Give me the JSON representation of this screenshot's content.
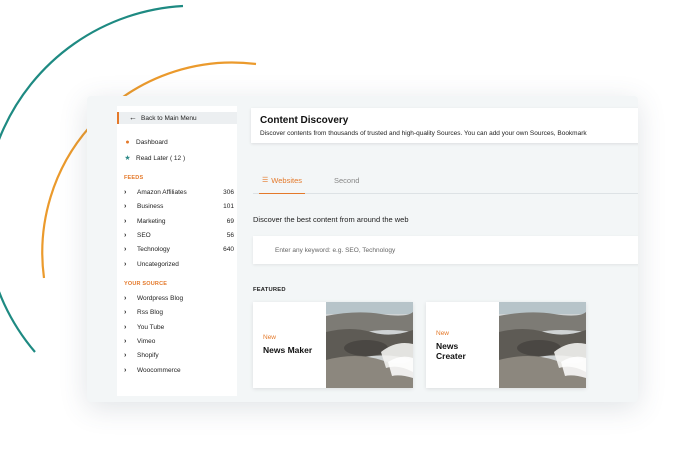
{
  "sidebar": {
    "back_label": "Back to Main Menu",
    "top_items": [
      {
        "label": "Dashboard",
        "icon": "dashboard-icon"
      },
      {
        "label": "Read Later ( 12 )",
        "icon": "star-icon"
      }
    ],
    "feeds_title": "FEEDS",
    "feeds": [
      {
        "label": "Amazon Affiliates",
        "count": "306"
      },
      {
        "label": "Business",
        "count": "101"
      },
      {
        "label": "Marketing",
        "count": "69"
      },
      {
        "label": "SEO",
        "count": "56"
      },
      {
        "label": "Technology",
        "count": "640"
      },
      {
        "label": "Uncategorized",
        "count": ""
      }
    ],
    "source_title": "YOUR SOURCE",
    "sources": [
      {
        "label": "Wordpress Blog"
      },
      {
        "label": "Rss Blog"
      },
      {
        "label": "You Tube"
      },
      {
        "label": "Vimeo"
      },
      {
        "label": "Shopify"
      },
      {
        "label": "Woocommerce"
      }
    ]
  },
  "header": {
    "title": "Content Discovery",
    "description": "Discover contents from thousands of trusted and high-quality Sources. You can add your own Sources, Bookmark"
  },
  "tabs": [
    {
      "label": "Websites",
      "active": true
    },
    {
      "label": "Second",
      "active": false
    }
  ],
  "discover_text": "Discover the best content from around the web",
  "search": {
    "placeholder": "Enter any keyword: e.g. SEO, Technology",
    "value": ""
  },
  "featured_title": "FEATURED",
  "cards": [
    {
      "badge": "New",
      "title": "News Maker"
    },
    {
      "badge": "New",
      "title": "News Creater"
    }
  ],
  "colors": {
    "accent": "#e4792a",
    "teal": "#2f8a88",
    "background": "#f3f6f7"
  }
}
